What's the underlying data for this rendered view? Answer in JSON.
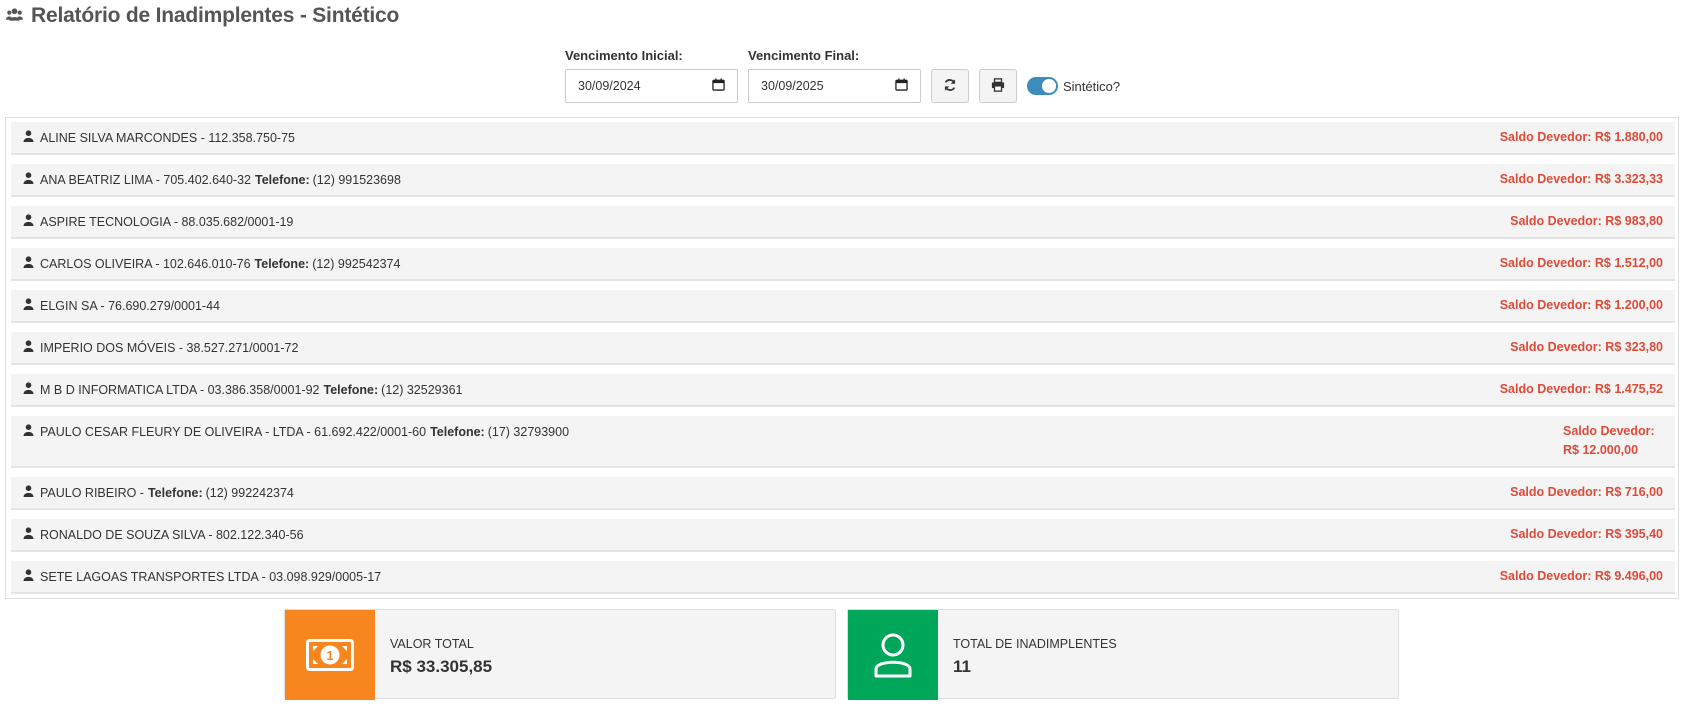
{
  "page": {
    "title": "Relatório de Inadimplentes - Sintético"
  },
  "filters": {
    "start_label": "Vencimento Inicial:",
    "start_value": "30/09/2024",
    "end_label": "Vencimento Final:",
    "end_value": "30/09/2025",
    "toggle_label": "Sintético?",
    "toggle_on": true
  },
  "debtors": [
    {
      "name": "ALINE SILVA MARCONDES - 112.358.750-75",
      "phone_label": "",
      "phone": "",
      "saldo": "Saldo Devedor: R$ 1.880,00"
    },
    {
      "name": "ANA BEATRIZ LIMA - 705.402.640-32",
      "phone_label": "Telefone:",
      "phone": "(12) 991523698",
      "saldo": "Saldo Devedor: R$ 3.323,33"
    },
    {
      "name": "ASPIRE TECNOLOGIA - 88.035.682/0001-19",
      "phone_label": "",
      "phone": "",
      "saldo": "Saldo Devedor: R$ 983,80"
    },
    {
      "name": "CARLOS OLIVEIRA - 102.646.010-76",
      "phone_label": "Telefone:",
      "phone": "(12) 992542374",
      "saldo": "Saldo Devedor: R$ 1.512,00"
    },
    {
      "name": "ELGIN SA - 76.690.279/0001-44",
      "phone_label": "",
      "phone": "",
      "saldo": "Saldo Devedor: R$ 1.200,00"
    },
    {
      "name": "IMPERIO DOS MÓVEIS - 38.527.271/0001-72",
      "phone_label": "",
      "phone": "",
      "saldo": "Saldo Devedor: R$ 323,80"
    },
    {
      "name": "M B D INFORMATICA LTDA - 03.386.358/0001-92",
      "phone_label": "Telefone:",
      "phone": "(12) 32529361",
      "saldo": "Saldo Devedor: R$ 1.475,52"
    },
    {
      "name": "PAULO CESAR FLEURY DE OLIVEIRA - LTDA - 61.692.422/0001-60",
      "phone_label": "Telefone:",
      "phone": "(17) 32793900",
      "saldo": "Saldo Devedor: R$ 12.000,00"
    },
    {
      "name": "PAULO RIBEIRO -",
      "phone_label": "Telefone:",
      "phone": "(12) 992242374",
      "saldo": "Saldo Devedor: R$ 716,00"
    },
    {
      "name": "RONALDO DE SOUZA SILVA - 802.122.340-56",
      "phone_label": "",
      "phone": "",
      "saldo": "Saldo Devedor: R$ 395,40"
    },
    {
      "name": "SETE LAGOAS TRANSPORTES LTDA - 03.098.929/0005-17",
      "phone_label": "",
      "phone": "",
      "saldo": "Saldo Devedor: R$ 9.496,00"
    }
  ],
  "summary": {
    "total_label": "VALOR TOTAL",
    "total_value": "R$ 33.305,85",
    "count_label": "TOTAL DE INADIMPLENTES",
    "count_value": "11"
  },
  "colors": {
    "saldo": "#dd4b39",
    "total_icon_bg": "#f7861e",
    "count_icon_bg": "#00a65a",
    "toggle": "#3c8dbc"
  }
}
